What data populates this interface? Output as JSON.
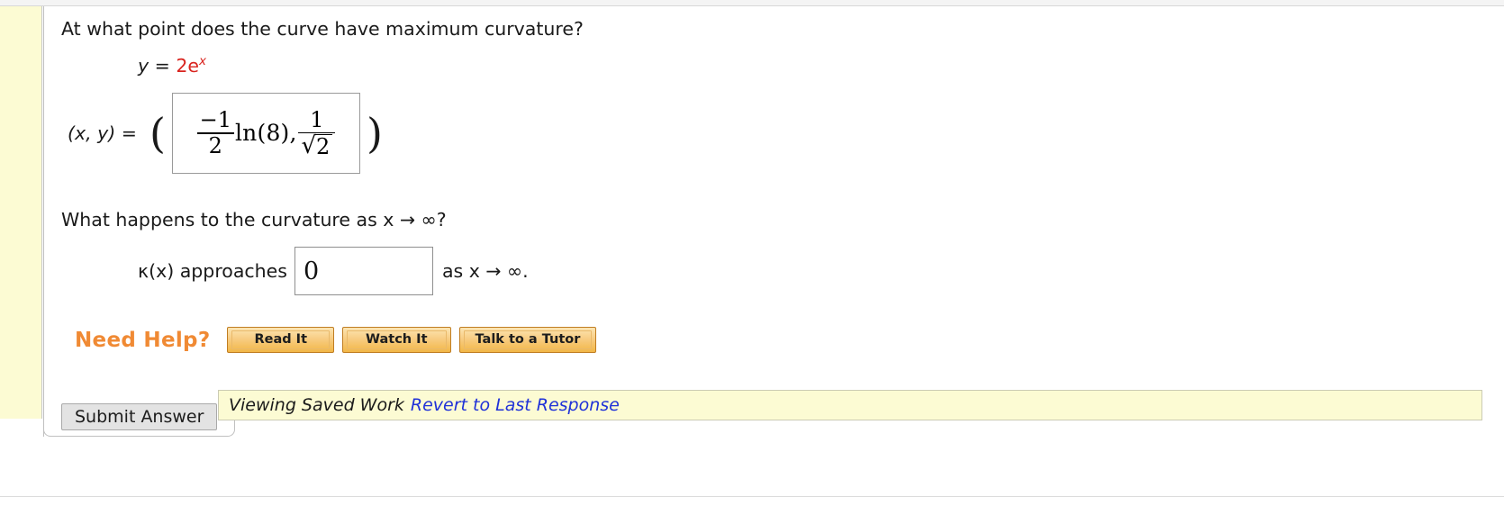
{
  "question": {
    "prompt_1": "At what point does the curve have maximum curvature?",
    "given_equation": {
      "lhs": "y = ",
      "coefficient": "2",
      "base": "e",
      "exponent": "x"
    },
    "coordinate_label": "(x, y) = ",
    "open_paren": "(",
    "close_paren": ")",
    "answer_expression": {
      "x_value": {
        "fraction_numerator": "−1",
        "fraction_denominator": "2",
        "function": "ln",
        "argument": "(8)"
      },
      "separator": ",",
      "y_value": {
        "fraction_numerator": "1",
        "radical": "√",
        "radicand": "2"
      },
      "plain_text": "(−1/2)ln(8), 1/√2"
    },
    "prompt_2": "What happens to the curvature as  x → ∞?",
    "limit_label": "κ(x) approaches",
    "limit_answer_value": "0",
    "limit_tail": "as x → ∞."
  },
  "need_help": {
    "label": "Need Help?",
    "buttons": [
      {
        "label": "Read It",
        "name": "read-it"
      },
      {
        "label": "Watch It",
        "name": "watch-it"
      },
      {
        "label": "Talk to a Tutor",
        "name": "talk-to-a-tutor"
      }
    ]
  },
  "footer": {
    "submit_label": "Submit Answer",
    "status_text": "Viewing Saved Work",
    "status_link": "Revert to Last Response"
  },
  "colors": {
    "accent_orange": "#f08a34",
    "equation_red": "#d9241f",
    "link_blue": "#2032d8",
    "status_yellow": "#fcfbd3",
    "button_amber": "#f2b747"
  }
}
